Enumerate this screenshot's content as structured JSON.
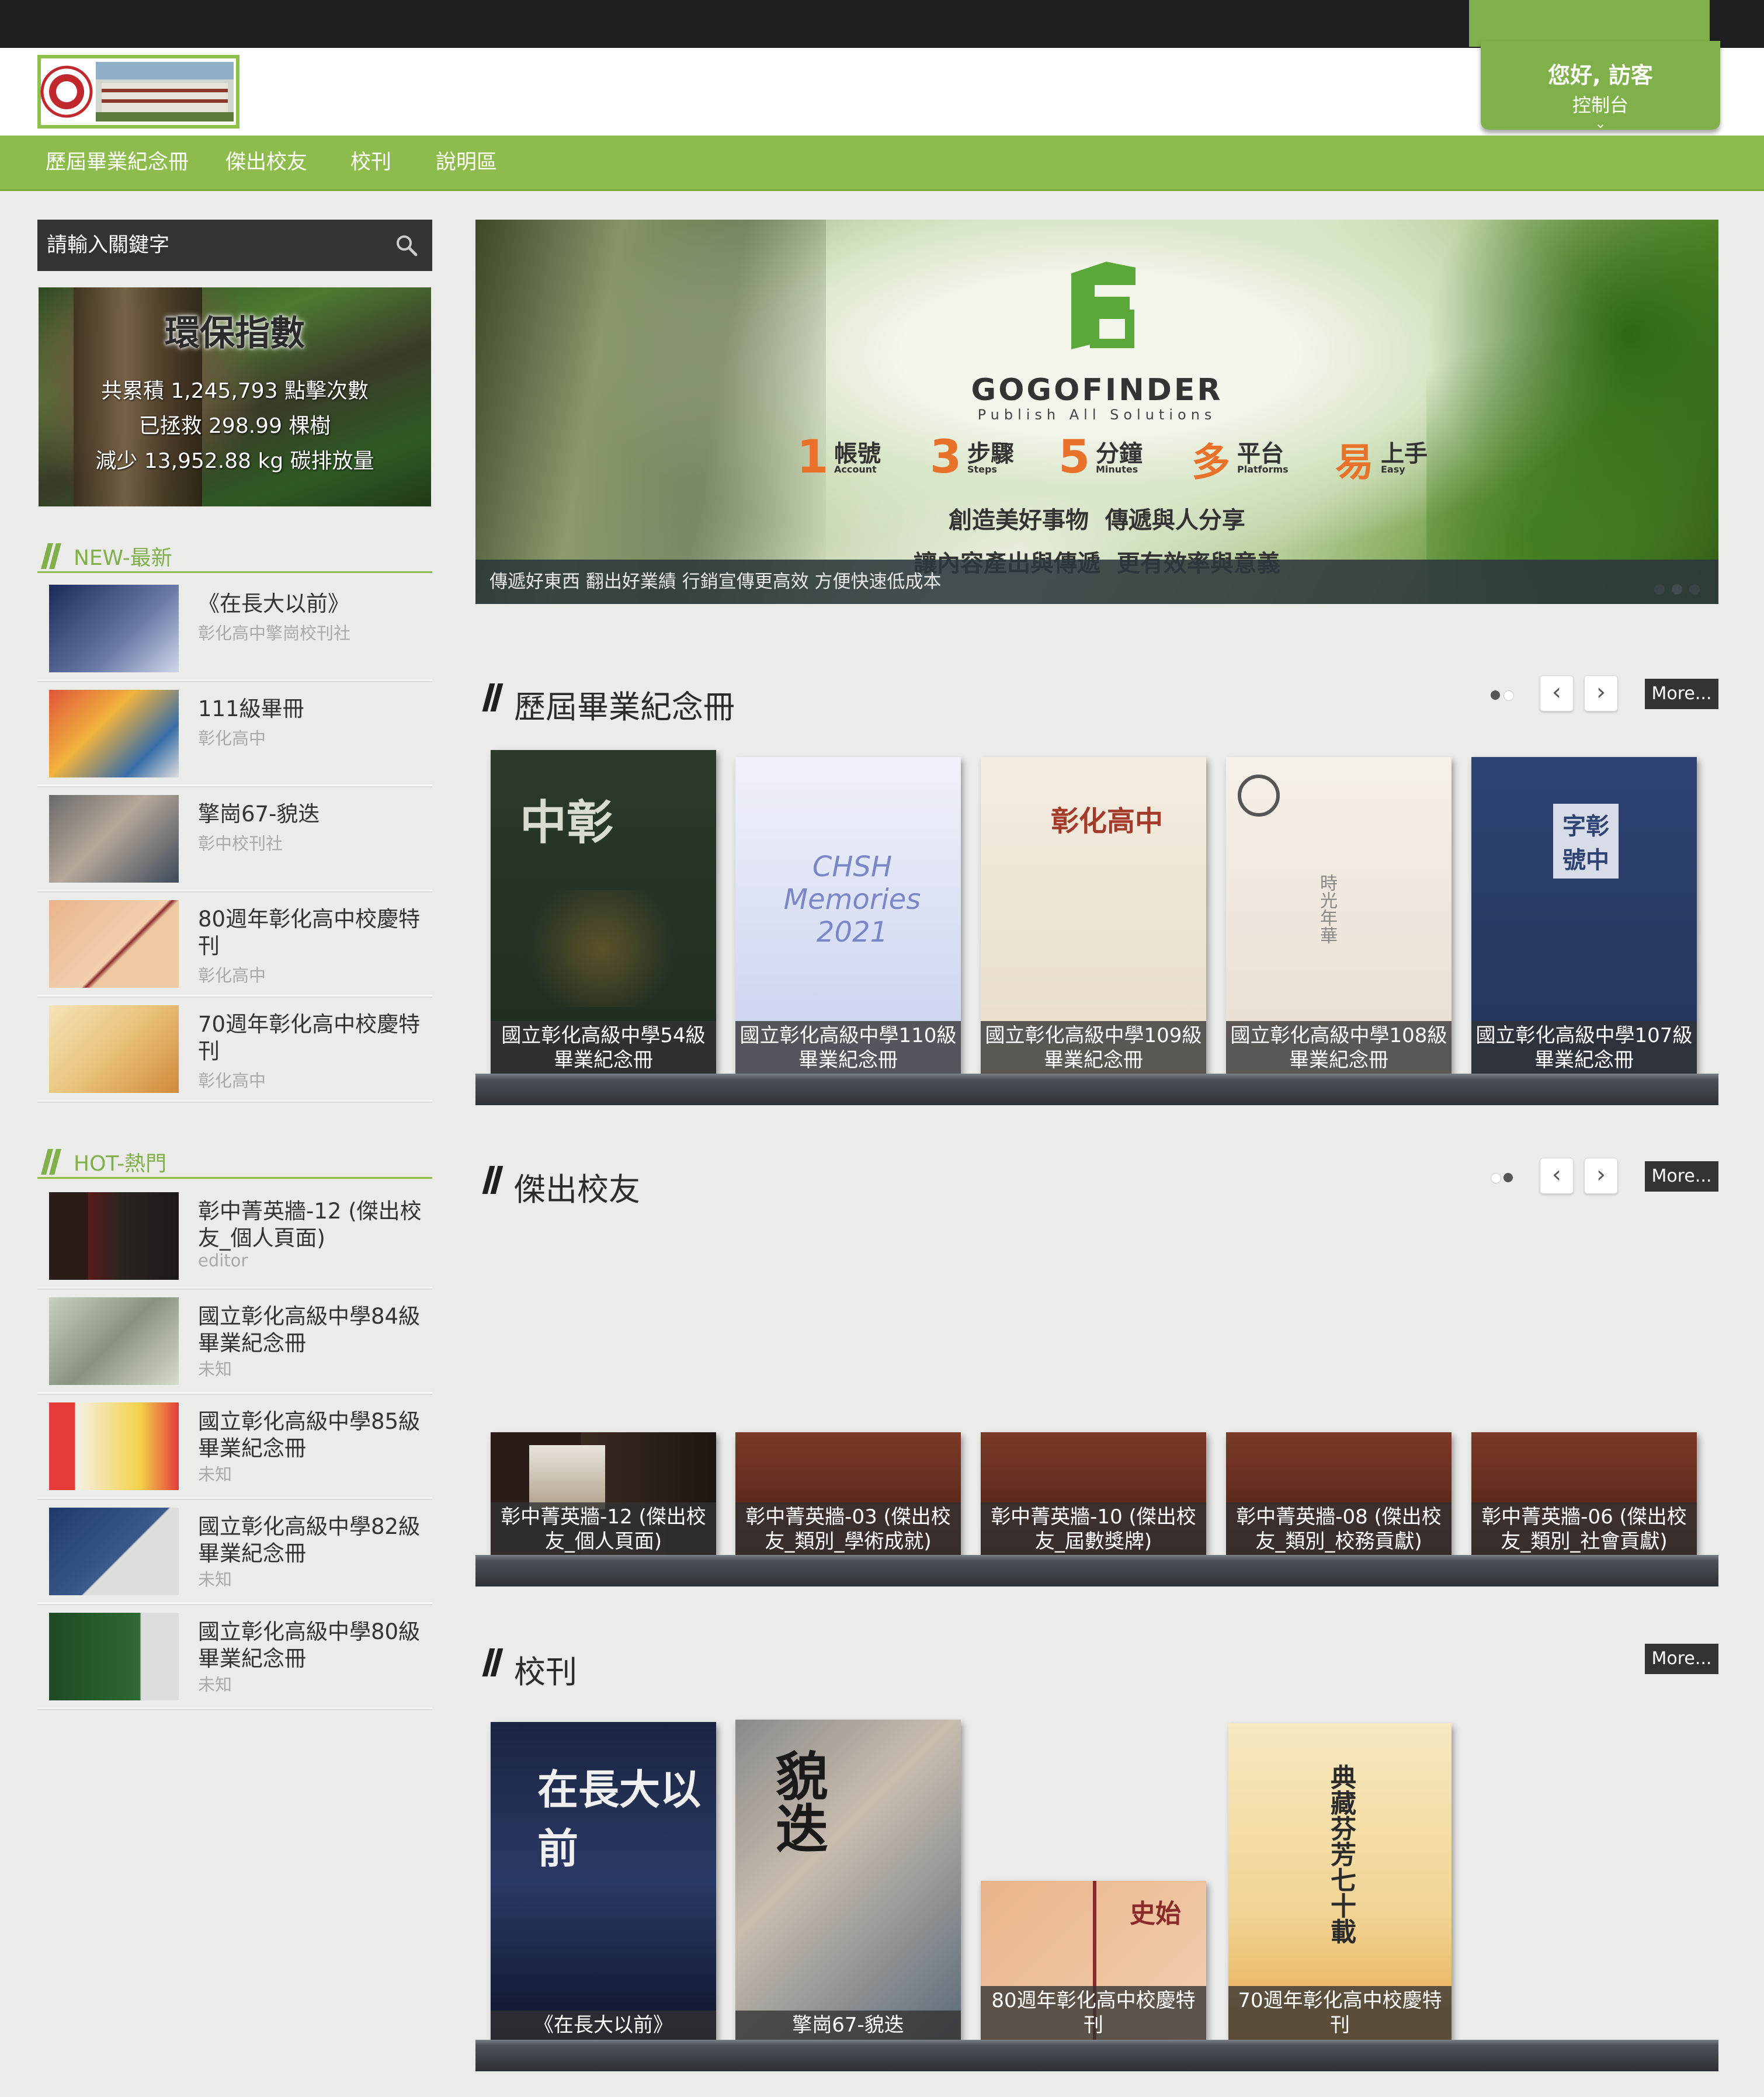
{
  "header": {
    "greeting": "您好, 訪客",
    "control_panel": "控制台"
  },
  "nav": {
    "items": [
      {
        "label": "歷屆畢業紀念冊"
      },
      {
        "label": "傑出校友"
      },
      {
        "label": "校刊"
      },
      {
        "label": "說明區"
      }
    ]
  },
  "search": {
    "placeholder": "請輸入關鍵字"
  },
  "eco": {
    "title": "環保指數",
    "line1": "共累積 1,245,793 點擊次數",
    "line2": "已拯救 298.99 棵樹",
    "line3": "減少 13,952.88 kg 碳排放量"
  },
  "sidebar_new": {
    "title": "NEW-最新",
    "items": [
      {
        "title": "《在長大以前》",
        "sub": "彰化高中擎崗校刊社"
      },
      {
        "title": "111級畢冊",
        "sub": "彰化高中"
      },
      {
        "title": "擎崗67-貌迭",
        "sub": "彰中校刊社"
      },
      {
        "title": "80週年彰化高中校慶特刊",
        "sub": "彰化高中"
      },
      {
        "title": "70週年彰化高中校慶特刊",
        "sub": "彰化高中"
      }
    ]
  },
  "sidebar_hot": {
    "title": "HOT-熱門",
    "items": [
      {
        "title": "彰中菁英牆-12 (傑出校友_個人頁面)",
        "sub": "editor"
      },
      {
        "title": "國立彰化高級中學84級畢業紀念冊",
        "sub": "未知"
      },
      {
        "title": "國立彰化高級中學85級畢業紀念冊",
        "sub": "未知"
      },
      {
        "title": "國立彰化高級中學82級畢業紀念冊",
        "sub": "未知"
      },
      {
        "title": "國立彰化高級中學80級畢業紀念冊",
        "sub": "未知"
      }
    ]
  },
  "banner": {
    "brand": "GOGOFINDER",
    "brand_sub": "Publish All Solutions",
    "features": [
      {
        "num": "1",
        "zh": "帳號",
        "en": "Account"
      },
      {
        "num": "3",
        "zh": "步驟",
        "en": "Steps"
      },
      {
        "num": "5",
        "zh": "分鐘",
        "en": "Minutes"
      },
      {
        "num": "多",
        "zh": "平台",
        "en": "Platforms"
      },
      {
        "num": "易",
        "zh": "上手",
        "en": "Easy"
      }
    ],
    "slogan1": "創造美好事物  傳遞與人分享",
    "slogan2": "讓內容產出與傳遞  更有效率與意義",
    "caption": "傳遞好東西 翻出好業績 行銷宣傳更高效 方便快速低成本"
  },
  "section_yearbooks": {
    "title": "歷屆畢業紀念冊",
    "more": "More...",
    "books": [
      {
        "caption": "國立彰化高級中學54級畢業紀念冊",
        "cover_text": "中彰",
        "color": "#2b3a2b"
      },
      {
        "caption": "國立彰化高級中學110級畢業紀念冊",
        "cover_text": "CHSH Memories 2021",
        "color": "#e2e6f4"
      },
      {
        "caption": "國立彰化高級中學109級畢業紀念冊",
        "cover_text": "彰化高中",
        "color": "#efe7d9"
      },
      {
        "caption": "國立彰化高級中學108級畢業紀念冊",
        "cover_text": "時光年華",
        "color": "#f1ebe3"
      },
      {
        "caption": "國立彰化高級中學107級畢業紀念冊",
        "cover_text": "字彰號中",
        "color": "#2a3e66"
      }
    ]
  },
  "section_alumni": {
    "title": "傑出校友",
    "more": "More...",
    "books": [
      {
        "caption": "彰中菁英牆-12 (傑出校友_個人頁面)"
      },
      {
        "caption": "彰中菁英牆-03 (傑出校友_類別_學術成就)"
      },
      {
        "caption": "彰中菁英牆-10 (傑出校友_屆數獎牌)"
      },
      {
        "caption": "彰中菁英牆-08 (傑出校友_類別_校務貢獻)"
      },
      {
        "caption": "彰中菁英牆-06 (傑出校友_類別_社會貢獻)"
      }
    ]
  },
  "section_journal": {
    "title": "校刊",
    "more": "More...",
    "books": [
      {
        "caption": "《在長大以前》",
        "cover_text": "在長大以前"
      },
      {
        "caption": "擎崗67-貌迭",
        "cover_text": "貌迭"
      },
      {
        "caption": "80週年彰化高中校慶特刊",
        "cover_text": "史始"
      },
      {
        "caption": "70週年彰化高中校慶特刊",
        "cover_text": "典藏芬芳七十載"
      }
    ]
  }
}
